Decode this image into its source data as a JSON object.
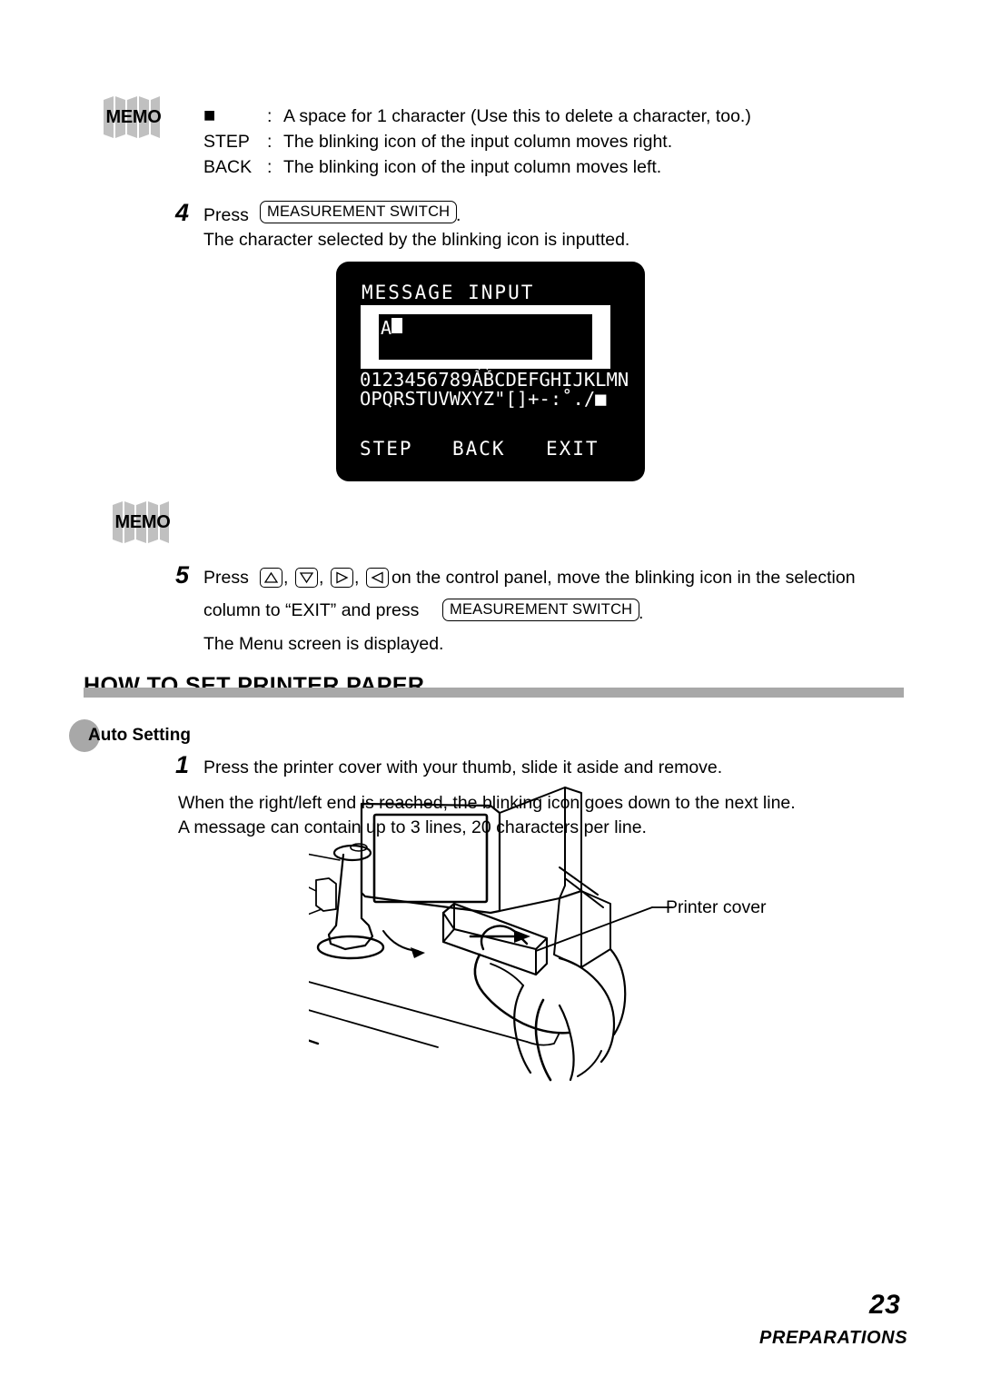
{
  "memo_top": {
    "label": "MEMO",
    "rows": [
      {
        "key": "■",
        "sep": ":",
        "desc": "A space for 1 character (Use this to delete a character, too.)"
      },
      {
        "key": "STEP",
        "sep": ":",
        "desc": "The blinking icon of the input column moves right."
      },
      {
        "key": "BACK",
        "sep": ":",
        "desc": "The blinking icon of the input column moves left."
      }
    ]
  },
  "step4": {
    "number": "4",
    "press_label": "Press",
    "key_measurement": "MEASUREMENT SWITCH",
    "period": ".",
    "result": "The character selected by the blinking icon is inputted."
  },
  "lcd": {
    "title": "MESSAGE INPUT",
    "input_value": "A",
    "char_row_1": "0123456789ABCDEFGHIJKLMN",
    "char_row_2": "OPQRSTUVWXYZ\"[]+-:˚./■",
    "softkeys": [
      "STEP",
      "BACK",
      "EXIT"
    ]
  },
  "memo_mid": {
    "label": "MEMO"
  },
  "step5": {
    "number": "5",
    "press_label": "Press",
    "keys": [
      "up-arrow",
      "down-arrow",
      "right-arrow",
      "left-arrow"
    ],
    "text_after_keys": "on the control panel, move the blinking icon in the selection",
    "line2_before": "column to “EXIT” and press",
    "key_measurement": "MEASUREMENT SWITCH",
    "period": ".",
    "line3": "The Menu screen is displayed."
  },
  "section": {
    "heading": "HOW TO SET PRINTER PAPER",
    "subheading": "Auto Setting",
    "bar_color": "#a8a8a8"
  },
  "step1": {
    "number": "1",
    "text": "Press the printer cover with your thumb, slide it aside and remove."
  },
  "overlap_note": {
    "line1": "When the right/left end is reached, the blinking icon goes down to the next line.",
    "line2": "A message can contain up to 3 lines, 20 characters per line."
  },
  "illustration": {
    "callout": "Printer cover"
  },
  "footer": {
    "page_number": "23",
    "section_label": "PREPARATIONS"
  }
}
